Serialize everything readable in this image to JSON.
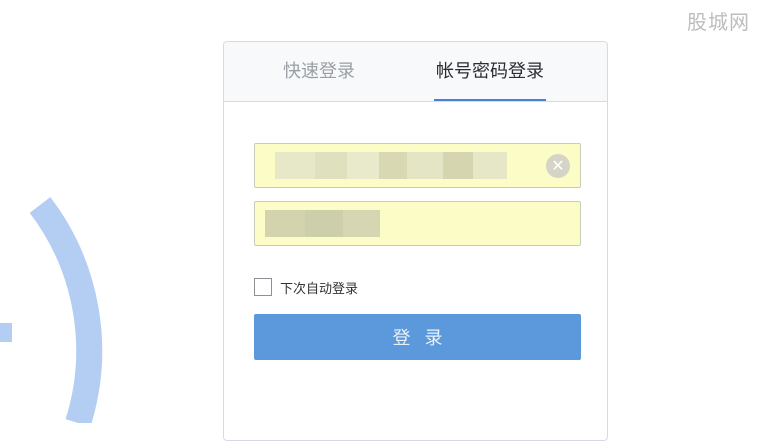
{
  "watermark": "股城网",
  "tabs": {
    "quick_login": "快速登录",
    "account_login": "帐号密码登录"
  },
  "form": {
    "username_value": "",
    "password_value": "",
    "clear_symbol": "✕",
    "remember_label": "下次自动登录",
    "remember_checked": false,
    "login_button": "登录"
  },
  "colors": {
    "accent": "#5b99dc",
    "tab_underline": "#4a7fd6",
    "autofill": "#fbfcc6",
    "arc": "#b3cdf3"
  }
}
